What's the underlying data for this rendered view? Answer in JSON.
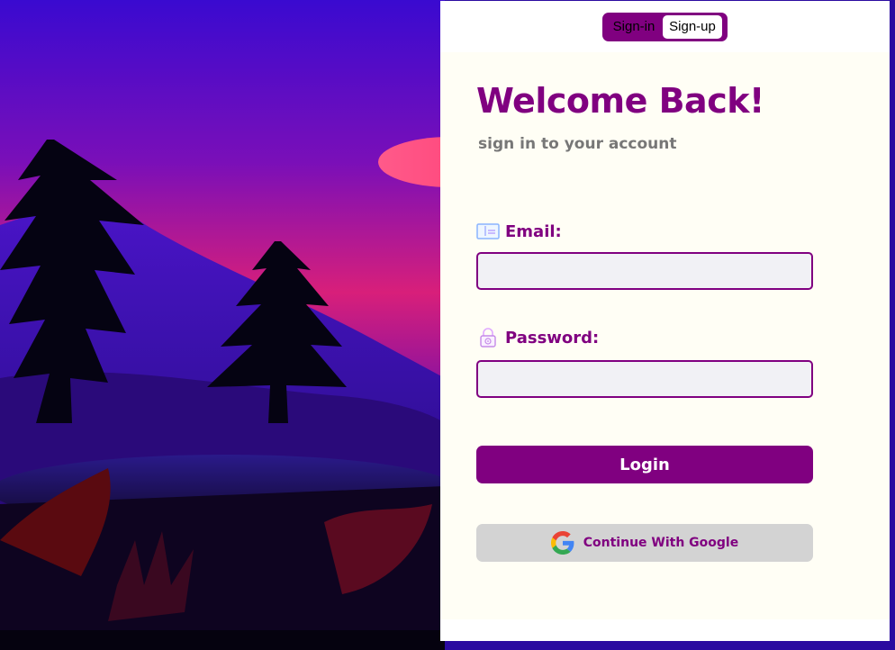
{
  "toggle": {
    "signin_label": "Sign-in",
    "signup_label": "Sign-up"
  },
  "form": {
    "title": "Welcome Back!",
    "subtitle": "sign in to your account",
    "email": {
      "icon": "id-card-icon",
      "label": "Email:",
      "value": "",
      "placeholder": ""
    },
    "password": {
      "icon": "lock-icon",
      "label": "Password:",
      "value": "",
      "placeholder": ""
    },
    "login_label": "Login",
    "google_label": "Continue With Google",
    "google_icon": "google-logo-icon"
  },
  "colors": {
    "accent": "#800080",
    "card_bg": "#fffef5",
    "input_bg": "#f1f1f5",
    "google_btn_bg": "#d3d3d3",
    "subtitle": "#777777"
  }
}
